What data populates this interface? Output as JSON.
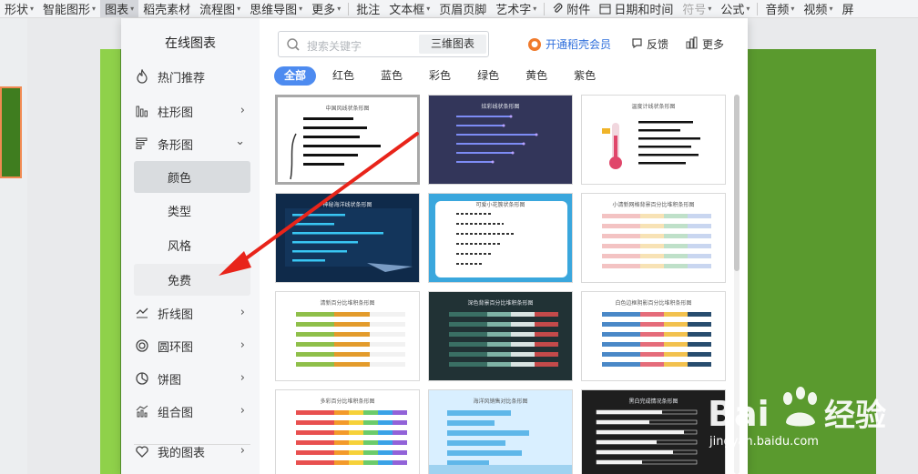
{
  "toolbar": {
    "items": [
      {
        "label": "形状",
        "caret": "▾"
      },
      {
        "label": "智能图形",
        "caret": "▾"
      },
      {
        "label": "图表",
        "caret": "▾"
      },
      {
        "label": "稻壳素材"
      },
      {
        "label": "流程图",
        "caret": "▾"
      },
      {
        "label": "思维导图",
        "caret": "▾"
      },
      {
        "label": "更多",
        "caret": "▾"
      },
      {
        "label": "批注"
      },
      {
        "label": "文本框",
        "caret": "▾"
      },
      {
        "label": "页眉页脚"
      },
      {
        "label": "艺术字",
        "caret": "▾"
      },
      {
        "label": "附件"
      },
      {
        "label": "日期和时间"
      },
      {
        "label": "符号",
        "caret": "▾"
      },
      {
        "label": "公式",
        "caret": "▾"
      },
      {
        "label": "音频",
        "caret": "▾"
      },
      {
        "label": "视频",
        "caret": "▾"
      },
      {
        "label": "屏"
      }
    ]
  },
  "panel": {
    "title": "在线图表",
    "categories": [
      {
        "label": "热门推荐",
        "icon": "fire-outline-icon"
      },
      {
        "label": "柱形图",
        "icon": "column-chart-icon",
        "chevron": "›"
      },
      {
        "label": "条形图",
        "icon": "bar-chart-icon",
        "chevron": "⌄"
      },
      {
        "label": "折线图",
        "icon": "line-chart-icon",
        "chevron": "›"
      },
      {
        "label": "圆环图",
        "icon": "ring-chart-icon",
        "chevron": "›"
      },
      {
        "label": "饼图",
        "icon": "pie-chart-icon",
        "chevron": "›"
      },
      {
        "label": "组合图",
        "icon": "combo-chart-icon",
        "chevron": "›"
      },
      {
        "label": "我的图表",
        "icon": "heart-icon",
        "chevron": "›"
      }
    ],
    "subcategories": [
      {
        "label": "颜色",
        "state": "selected"
      },
      {
        "label": "类型"
      },
      {
        "label": "风格"
      },
      {
        "label": "免费",
        "state": "hover"
      }
    ],
    "search": {
      "placeholder": "搜索关键字",
      "three_d_label": "三维图表"
    },
    "open_member": "开通稻壳会员",
    "feedback": "反馈",
    "more": "更多",
    "filters": [
      "全部",
      "红色",
      "蓝色",
      "彩色",
      "绿色",
      "黄色",
      "紫色"
    ],
    "templates": [
      {
        "title": "中国风线状条形图",
        "theme": "ink"
      },
      {
        "title": "炫彩线状条形图",
        "theme": "navy"
      },
      {
        "title": "温度计线状条形图",
        "theme": "thermo"
      },
      {
        "title": "神秘海洋线状条形图",
        "theme": "ocean"
      },
      {
        "title": "可爱小花簇状条形图",
        "theme": "flower"
      },
      {
        "title": "小清新网格背景百分比堆积条形图",
        "theme": "pastel"
      },
      {
        "title": "清新百分比堆积条形图",
        "theme": "fresh"
      },
      {
        "title": "深色背景百分比堆积条形图",
        "theme": "darkgreen"
      },
      {
        "title": "白色边框阴影百分比堆积条形图",
        "theme": "bordered"
      },
      {
        "title": "多彩百分比堆积条形图",
        "theme": "rainbow"
      },
      {
        "title": "海洋风销售对比条形图",
        "theme": "sea"
      },
      {
        "title": "黑白完成情况条形图",
        "theme": "bw"
      }
    ]
  },
  "watermark": {
    "brand": "Bai 经验",
    "url": "jingyan.baidu.com"
  },
  "colors": {
    "accent": "#4d8bf0",
    "link": "#2f6fdc",
    "arrow": "#e8241a",
    "slide": "#5a9a2e"
  }
}
